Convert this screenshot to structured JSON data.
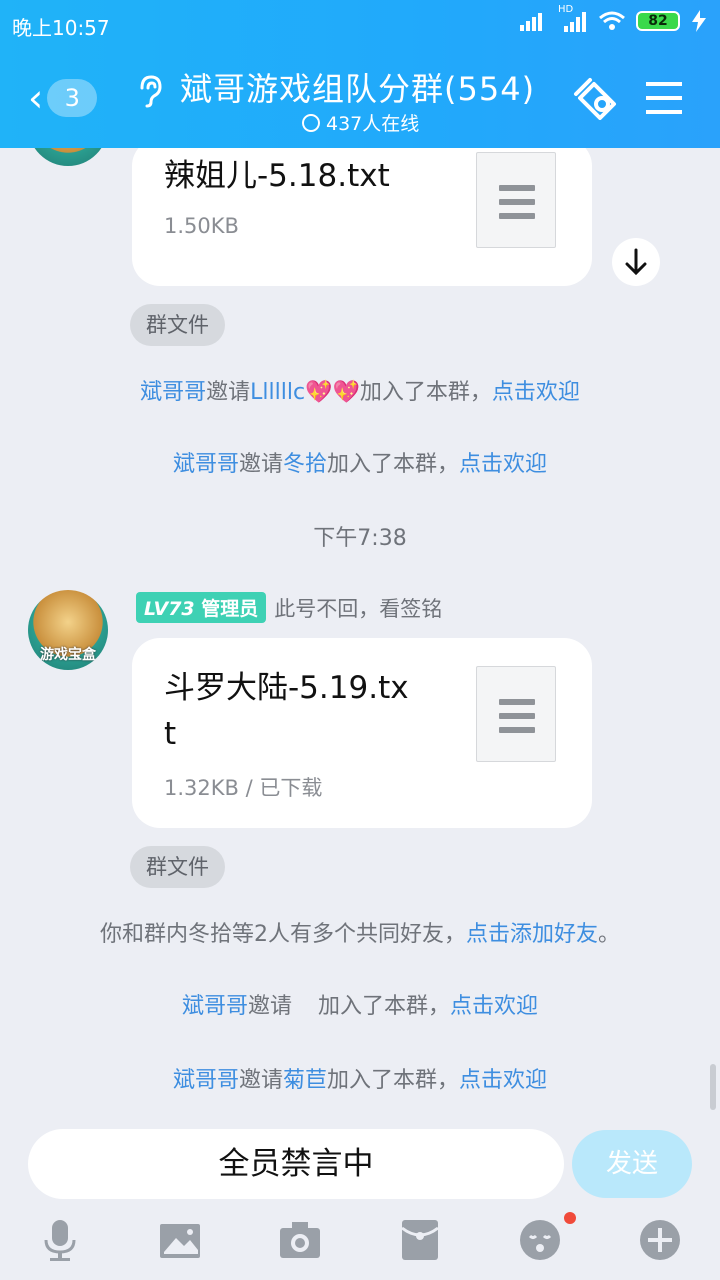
{
  "status_bar": {
    "time": "晚上10:57",
    "hd": "HD",
    "battery": "82"
  },
  "header": {
    "back_count": "3",
    "title": "斌哥游戏组队分群(554)",
    "online": "437人在线",
    "accent": "#21a9fb"
  },
  "messages": {
    "file1": {
      "name": "辣姐儿-5.18.txt",
      "size": "1.50KB",
      "tag": "群文件"
    },
    "sys1": {
      "inviter": "斌哥哥",
      "verb": "邀请",
      "invitee": "Llllllc💖💖",
      "tail": "加入了本群，",
      "action": "点击欢迎"
    },
    "sys2": {
      "inviter": "斌哥哥",
      "verb": "邀请",
      "invitee": "冬拾",
      "tail": "加入了本群，",
      "action": "点击欢迎"
    },
    "timestamp": "下午7:38",
    "sender": {
      "level": "LV73",
      "role": "管理员",
      "name": "此号不回，看签铭",
      "avatar_caption": "游戏宝盒"
    },
    "file2": {
      "name_line1": "斗罗大陆-5.19.tx",
      "name_line2": "t",
      "size": "1.32KB / 已下载",
      "tag": "群文件"
    },
    "sys3": {
      "text": "你和群内冬拾等2人有多个共同好友，",
      "action": "点击添加好友",
      "end": "。"
    },
    "sys4": {
      "inviter": "斌哥哥",
      "verb": "邀请",
      "invitee": "　",
      "tail": "加入了本群，",
      "action": "点击欢迎"
    },
    "sys5": {
      "inviter": "斌哥哥",
      "verb": "邀请",
      "invitee": "菊苣",
      "tail": "加入了本群，",
      "action": "点击欢迎"
    }
  },
  "input": {
    "muted_text": "全员禁言中",
    "send_label": "发送"
  },
  "toolbar": [
    "microphone-icon",
    "image-icon",
    "camera-icon",
    "red-packet-icon",
    "emoji-icon",
    "plus-icon"
  ]
}
